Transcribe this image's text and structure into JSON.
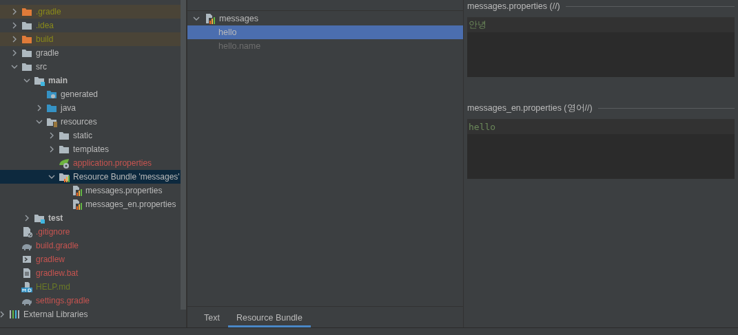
{
  "project_tree": {
    "items": [
      {
        "label": ".gradle",
        "kind": "folder",
        "color": "#8a8a1a",
        "excluded": true,
        "selected": false,
        "expanded": false
      },
      {
        "label": ".idea",
        "kind": "folder",
        "color": "#8a8a1a",
        "excluded": false,
        "selected": false,
        "expanded": false
      },
      {
        "label": "build",
        "kind": "folder",
        "color": "#8a8a1a",
        "excluded": true,
        "selected": false,
        "expanded": false
      },
      {
        "label": "gradle",
        "kind": "folder",
        "color": "#bbbbbb",
        "excluded": false,
        "selected": false,
        "expanded": false
      },
      {
        "label": "src",
        "kind": "folder",
        "color": "#bbbbbb",
        "excluded": false,
        "selected": false,
        "expanded": true,
        "children": [
          {
            "label": "main",
            "kind": "module",
            "color": "#bbbbbb",
            "excluded": false,
            "selected": false,
            "expanded": true,
            "children": [
              {
                "label": "generated",
                "kind": "generated",
                "color": "#bbbbbb",
                "excluded": false,
                "selected": false
              },
              {
                "label": "java",
                "kind": "sources",
                "color": "#bbbbbb",
                "excluded": false,
                "selected": false,
                "expanded": false
              },
              {
                "label": "resources",
                "kind": "resources",
                "color": "#bbbbbb",
                "excluded": false,
                "selected": false,
                "expanded": true,
                "children": [
                  {
                    "label": "static",
                    "kind": "folder",
                    "color": "#bbbbbb",
                    "excluded": false,
                    "selected": false,
                    "expanded": false
                  },
                  {
                    "label": "templates",
                    "kind": "folder",
                    "color": "#bbbbbb",
                    "excluded": false,
                    "selected": false,
                    "expanded": false
                  },
                  {
                    "label": "application.properties",
                    "kind": "spring",
                    "color": "#c75450",
                    "excluded": false,
                    "selected": false
                  },
                  {
                    "label": "Resource Bundle 'messages'",
                    "kind": "bundle",
                    "color": "#bbbbbb",
                    "excluded": false,
                    "selected": true,
                    "expanded": true,
                    "children": [
                      {
                        "label": "messages.properties",
                        "kind": "bundlefile",
                        "color": "#bbbbbb",
                        "excluded": false,
                        "selected": false
                      },
                      {
                        "label": "messages_en.properties",
                        "kind": "bundlefile",
                        "color": "#bbbbbb",
                        "excluded": false,
                        "selected": false
                      }
                    ]
                  }
                ]
              }
            ]
          },
          {
            "label": "test",
            "kind": "module",
            "color": "#bbbbbb",
            "excluded": false,
            "selected": false,
            "expanded": false
          }
        ]
      },
      {
        "label": ".gitignore",
        "kind": "ignorefile",
        "color": "#c75450",
        "excluded": false,
        "selected": false
      },
      {
        "label": "build.gradle",
        "kind": "gradle",
        "color": "#c75450",
        "excluded": false,
        "selected": false
      },
      {
        "label": "gradlew",
        "kind": "shell",
        "color": "#c75450",
        "excluded": false,
        "selected": false
      },
      {
        "label": "gradlew.bat",
        "kind": "textfile",
        "color": "#c75450",
        "excluded": false,
        "selected": false
      },
      {
        "label": "HELP.md",
        "kind": "markdown",
        "color": "#6b7a26",
        "excluded": false,
        "selected": false
      },
      {
        "label": "settings.gradle",
        "kind": "gradle",
        "color": "#c75450",
        "excluded": false,
        "selected": false
      }
    ],
    "roots": [
      {
        "label": "External Libraries",
        "kind": "libraries",
        "color": "#bbbbbb",
        "excluded": false,
        "selected": false,
        "expanded": false
      }
    ]
  },
  "bundle_keys": {
    "root": {
      "label": "messages",
      "expanded": true
    },
    "keys": [
      {
        "label": "hello",
        "selected": true,
        "dimmed": false
      },
      {
        "label": "hello.name",
        "selected": false,
        "dimmed": true
      }
    ]
  },
  "editors": [
    {
      "title": "messages.properties (//)",
      "value": "안녕"
    },
    {
      "title": "messages_en.properties (영어//)",
      "value": "hello"
    }
  ],
  "tabs": [
    {
      "label": "Text",
      "selected": false
    },
    {
      "label": "Resource Bundle",
      "selected": true
    }
  ]
}
